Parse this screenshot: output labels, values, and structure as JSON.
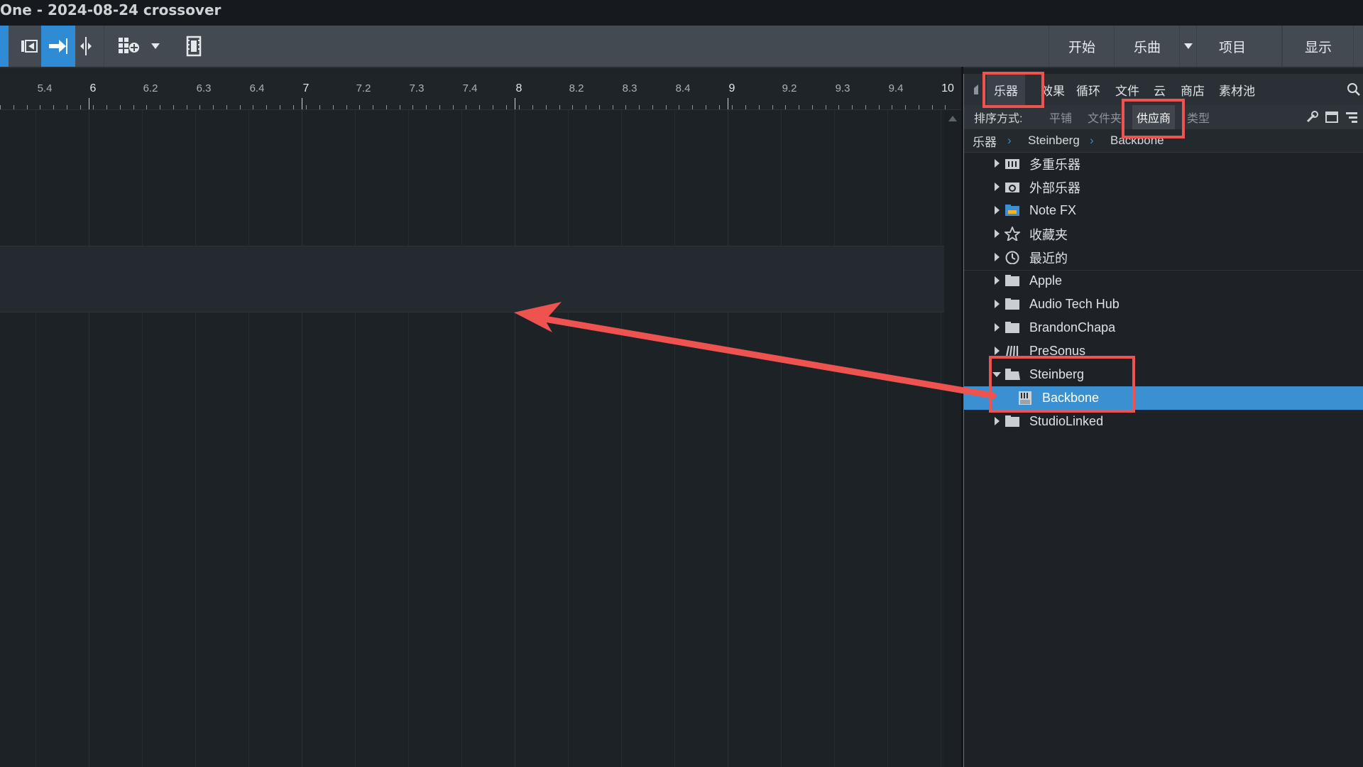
{
  "window": {
    "title": "One - 2024-08-24 crossover"
  },
  "toolbar": {
    "tools": [
      {
        "name": "loop-tool",
        "active": false
      },
      {
        "name": "insert-tool",
        "active": true
      },
      {
        "name": "split-tool",
        "active": false
      },
      {
        "name": "grid-tool",
        "active": false
      },
      {
        "name": "video-tool",
        "active": false
      }
    ],
    "start_label": "开始",
    "song_label": "乐曲",
    "project_label": "项目",
    "show_label": "显示"
  },
  "ruler": {
    "labels": [
      "5.4",
      "6",
      "6.2",
      "6.3",
      "6.4",
      "7",
      "7.2",
      "7.3",
      "7.4",
      "8",
      "8.2",
      "8.3",
      "8.4",
      "9",
      "9.2",
      "9.3",
      "9.4",
      "10"
    ]
  },
  "browser": {
    "tabs": [
      "乐器",
      "效果",
      "循环",
      "文件",
      "云",
      "商店",
      "素材池"
    ],
    "selected_tab": "乐器",
    "sort_label": "排序方式:",
    "sort_options": [
      "平铺",
      "文件夹",
      "供应商",
      "类型"
    ],
    "selected_sort": "供应商",
    "breadcrumb": [
      "乐器",
      "Steinberg",
      "Backbone"
    ],
    "tree": [
      {
        "label": "多重乐器",
        "icon": "multi-instrument-icon",
        "expanded": false,
        "level": 0
      },
      {
        "label": "外部乐器",
        "icon": "external-instrument-icon",
        "expanded": false,
        "level": 0
      },
      {
        "label": "Note FX",
        "icon": "note-fx-folder-icon",
        "expanded": false,
        "level": 0
      },
      {
        "label": "收藏夹",
        "icon": "star-icon",
        "expanded": false,
        "level": 0
      },
      {
        "label": "最近的",
        "icon": "clock-icon",
        "expanded": false,
        "level": 0
      },
      {
        "label": "Apple",
        "icon": "folder-icon",
        "expanded": false,
        "level": 0
      },
      {
        "label": "Audio Tech Hub",
        "icon": "folder-icon",
        "expanded": false,
        "level": 0
      },
      {
        "label": "BrandonChapa",
        "icon": "folder-icon",
        "expanded": false,
        "level": 0
      },
      {
        "label": "PreSonus",
        "icon": "presonus-icon",
        "expanded": false,
        "level": 0
      },
      {
        "label": "Steinberg",
        "icon": "folder-open-icon",
        "expanded": true,
        "level": 0
      },
      {
        "label": "Backbone",
        "icon": "au-plugin-icon",
        "expanded": false,
        "level": 1,
        "selected": true
      },
      {
        "label": "StudioLinked",
        "icon": "folder-icon",
        "expanded": false,
        "level": 0
      }
    ]
  },
  "colors": {
    "accent": "#2f8bd3",
    "selection": "#3a90d0",
    "annotation": "#ef5350"
  }
}
